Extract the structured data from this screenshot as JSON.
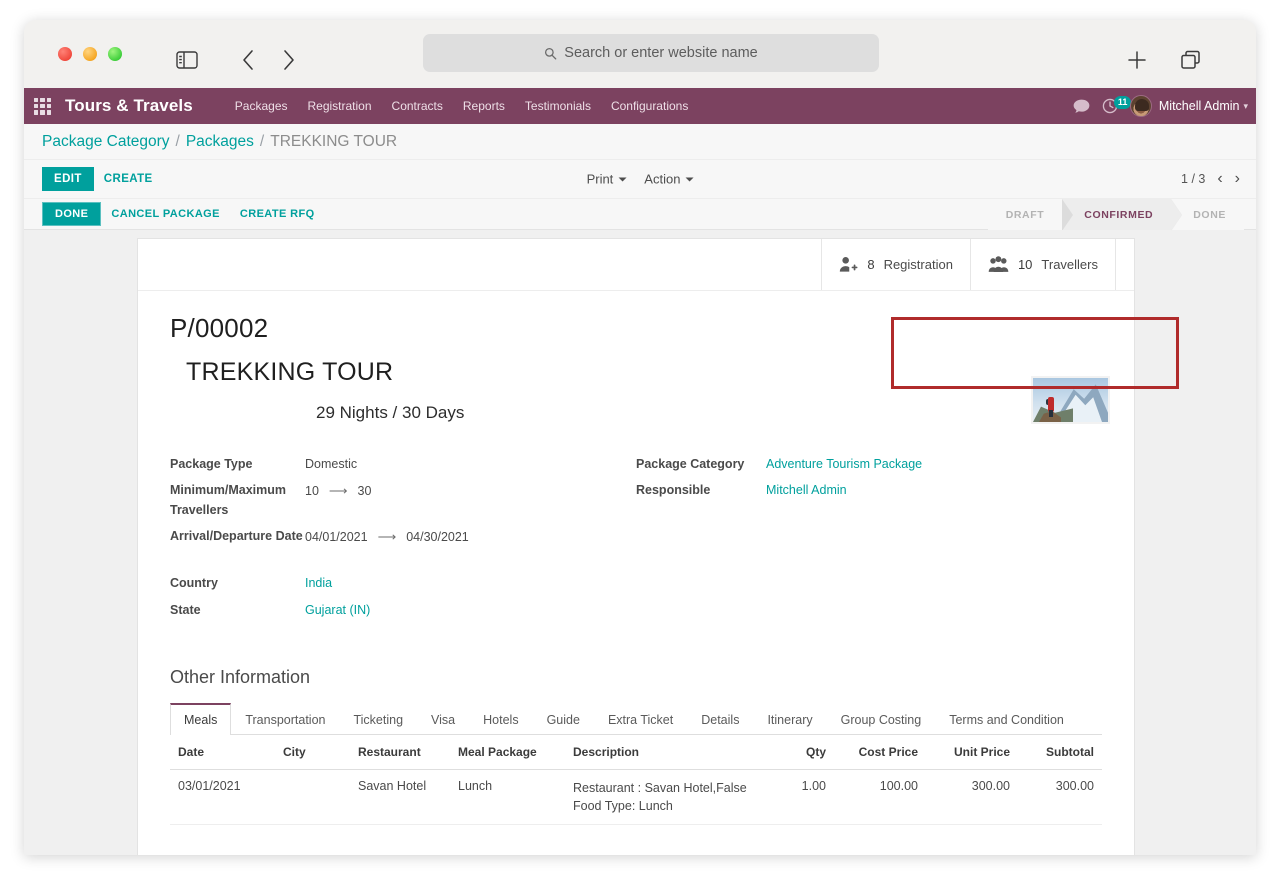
{
  "browser": {
    "address_placeholder": "Search or enter website name",
    "icons": {
      "search": "search-icon",
      "sidebar": "sidebar-toggle-icon",
      "back": "back-arrow-icon",
      "forward": "forward-arrow-icon",
      "new_tab": "plus-icon",
      "tab_overview": "tab-overview-icon"
    }
  },
  "navbar": {
    "brand": "Tours & Travels",
    "menu": [
      "Packages",
      "Registration",
      "Contracts",
      "Reports",
      "Testimonials",
      "Configurations"
    ],
    "activity_count": "11",
    "user": "Mitchell Admin",
    "color": "#7c4260"
  },
  "breadcrumb": {
    "items": [
      {
        "label": "Package Category",
        "active": false
      },
      {
        "label": "Packages",
        "active": false
      },
      {
        "label": "TREKKING TOUR",
        "active": true
      }
    ],
    "separator": "/"
  },
  "control_panel": {
    "edit_label": "EDIT",
    "create_label": "CREATE",
    "print_label": "Print",
    "action_label": "Action",
    "pager": "1 / 3"
  },
  "statusbar": {
    "done_label": "DONE",
    "cancel_label": "CANCEL PACKAGE",
    "rfq_label": "CREATE RFQ",
    "stages": [
      {
        "label": "DRAFT",
        "active": false
      },
      {
        "label": "CONFIRMED",
        "active": true
      },
      {
        "label": "DONE",
        "active": false
      }
    ]
  },
  "stat_buttons": [
    {
      "icon": "user-plus-icon",
      "value": "8",
      "label": "Registration"
    },
    {
      "icon": "users-group-icon",
      "value": "10",
      "label": "Travellers"
    }
  ],
  "record": {
    "code": "P/00002",
    "title": "TREKKING TOUR",
    "subtitle": "29 Nights / 30 Days",
    "photo_alt": "hiker-on-mountain-photo"
  },
  "fields_left": [
    {
      "label": "Package Type",
      "value": "Domestic",
      "type": "text"
    },
    {
      "label": "Minimum/Maximum Travellers",
      "value": "10",
      "value2": "30",
      "type": "range"
    },
    {
      "label": "Arrival/Departure Date",
      "value": "04/01/2021",
      "value2": "04/30/2021",
      "type": "range"
    },
    {
      "label": "Country",
      "value": "India",
      "type": "link"
    },
    {
      "label": "State",
      "value": "Gujarat (IN)",
      "type": "link"
    }
  ],
  "fields_right": [
    {
      "label": "Package Category",
      "value": "Adventure Tourism Package",
      "type": "link"
    },
    {
      "label": "Responsible",
      "value": "Mitchell Admin",
      "type": "link"
    }
  ],
  "notebook": {
    "section_title": "Other Information",
    "tabs": [
      {
        "label": "Meals",
        "active": true
      },
      {
        "label": "Transportation",
        "active": false
      },
      {
        "label": "Ticketing",
        "active": false
      },
      {
        "label": "Visa",
        "active": false
      },
      {
        "label": "Hotels",
        "active": false
      },
      {
        "label": "Guide",
        "active": false
      },
      {
        "label": "Extra Ticket",
        "active": false
      },
      {
        "label": "Details",
        "active": false
      },
      {
        "label": "Itinerary",
        "active": false
      },
      {
        "label": "Group Costing",
        "active": false
      },
      {
        "label": "Terms and Condition",
        "active": false
      }
    ]
  },
  "meals_table": {
    "columns": [
      "Date",
      "City",
      "Restaurant",
      "Meal Package",
      "Description",
      "Qty",
      "Cost Price",
      "Unit Price",
      "Subtotal"
    ],
    "rows": [
      {
        "date": "03/01/2021",
        "city": "",
        "restaurant": "Savan Hotel",
        "meal_package": "Lunch",
        "description_1": "Restaurant : Savan Hotel,False",
        "description_2": "Food Type: Lunch",
        "qty": "1.00",
        "cost_price": "100.00",
        "unit_price": "300.00",
        "subtotal": "300.00"
      }
    ]
  },
  "annotation": {
    "name": "stat-buttons-highlight",
    "color": "#b02b2b"
  }
}
